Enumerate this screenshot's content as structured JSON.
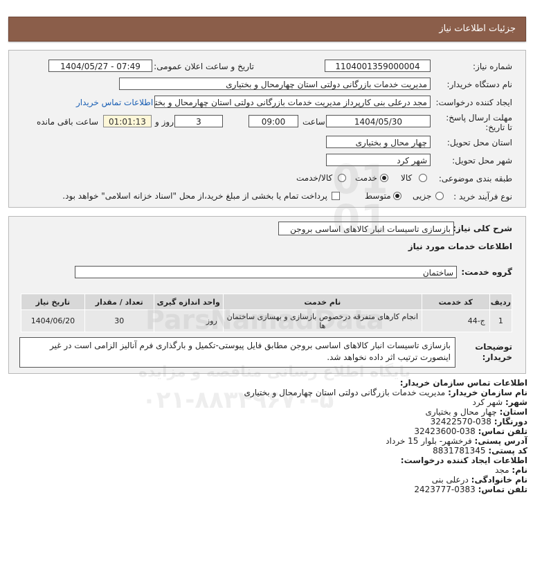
{
  "header": {
    "title": "جزئیات اطلاعات نیاز"
  },
  "form": {
    "need_number_label": "شماره نیاز:",
    "need_number": "1104001359000004",
    "announce_label": "تاریخ و ساعت اعلان عمومی:",
    "announce_value": "1404/05/27 - 07:49",
    "buyer_org_label": "نام دستگاه خریدار:",
    "buyer_org": "مدیریت خدمات بازرگانی دولتی استان چهارمحال و بختیاری",
    "requester_label": "ایجاد کننده درخواست:",
    "requester": "مجد درعلی بنی کارپرداز مدیریت خدمات بازرگانی دولتی استان چهارمحال و بختیاری",
    "contact_link": "اطلاعات تماس خریدار",
    "deadline_label": "مهلت ارسال پاسخ: تا تاریخ:",
    "deadline_date": "1404/05/30",
    "time_label": "ساعت",
    "deadline_time": "09:00",
    "days_value": "3",
    "days_label": "روز و",
    "remaining_time": "01:01:13",
    "remaining_label": "ساعت باقی مانده",
    "province_label": "استان محل تحویل:",
    "province": "چهار محال و بختیاری",
    "city_label": "شهر محل تحویل:",
    "city": "شهر کرد",
    "category_label": "طبقه بندی موضوعی:",
    "category_options": [
      "کالا",
      "خدمت",
      "کالا/خدمت"
    ],
    "category_selected": 1,
    "process_label": "نوع فرآیند خرید :",
    "process_options": [
      "جزیی",
      "متوسط"
    ],
    "process_selected": 1,
    "payment_note": "پرداخت تمام یا بخشی از مبلغ خرید،از محل \"اسناد خزانه اسلامی\" خواهد بود."
  },
  "need": {
    "summary_label": "شرح کلی نیاز:",
    "summary": "بازسازی تاسیسات انبار کالاهای اساسی بروجن",
    "services_title": "اطلاعات خدمات مورد نیاز",
    "service_group_label": "گروه خدمت:",
    "service_group": "ساختمان",
    "table": {
      "headers": [
        "ردیف",
        "کد خدمت",
        "نام خدمت",
        "واحد اندازه گیری",
        "تعداد / مقدار",
        "تاریخ نیاز"
      ],
      "rows": [
        [
          "1",
          "ج-44",
          "انجام کارهای متفرقه درخصوص بازسازی و بهسازی ساختمان ها",
          "روز",
          "30",
          "1404/06/20"
        ]
      ]
    },
    "buyer_desc_label": "توضیحات خریدار:",
    "buyer_desc": "بازسازی تاسیسات انبار کالاهای اساسی بروجن مطابق فایل پیوستی-تکمیل و بارگذاری فرم آنالیز الزامی است در غیر اینصورت ترتیب اثر داده نخواهد شد."
  },
  "contact": {
    "org_title": "اطلاعات تماس سازمان خریدار:",
    "org_name_label": "نام سازمان خریدار:",
    "org_name": "مدیریت خدمات بازرگانی دولتی استان چهارمحال و بختیاری",
    "city_label": "شهر:",
    "city": "شهر کرد",
    "province_label": "استان:",
    "province": "چهار محال و بختیاری",
    "fax_label": "دورنگار:",
    "fax": "038-32422570",
    "phone_label": "تلفن تماس:",
    "phone": "038-32423600",
    "address_label": "آدرس پستی:",
    "address": "فرخشهر- بلوار 15 خرداد",
    "postal_label": "کد پستی:",
    "postal": "8831781345",
    "creator_title": "اطلاعات ایجاد کننده درخواست:",
    "first_name_label": "نام:",
    "first_name": "مجد",
    "last_name_label": "نام خانوادگی:",
    "last_name": "درعلی بنی",
    "creator_phone_label": "تلفن تماس:",
    "creator_phone": "0383-2423777"
  },
  "watermark": {
    "brand": "ParsNamadData",
    "tagline": "پایگاه اطلاع رسانی مناقصه و مزایده",
    "phone": "۰۲۱-۸۸۳۴۹۶۷۰-۵",
    "digits": "0101"
  },
  "colors": {
    "header_bg": "#8b5e4a",
    "link": "#1a5fb4",
    "timer_bg": "#fdf7d8"
  }
}
